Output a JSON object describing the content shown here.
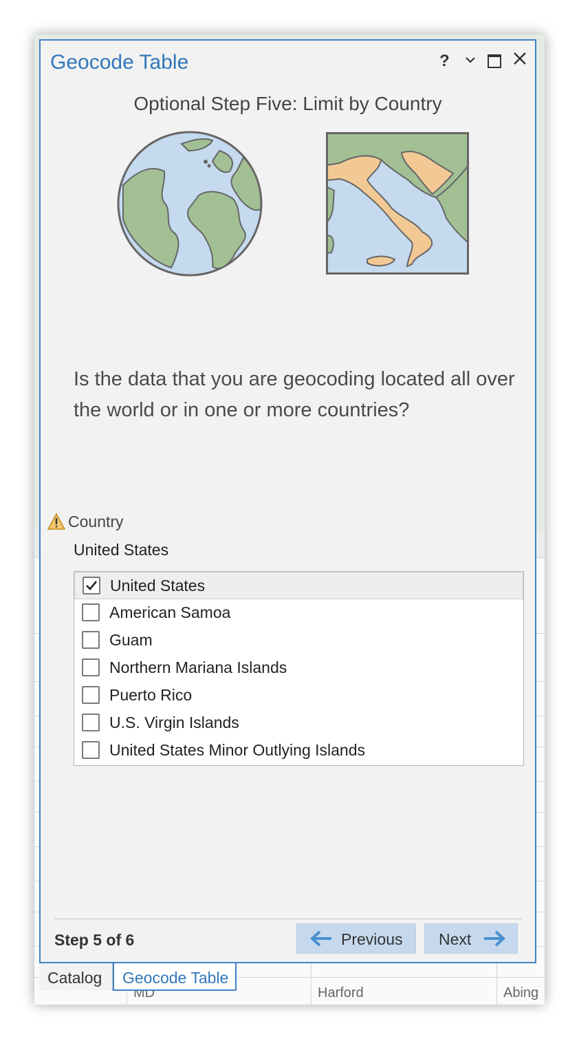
{
  "panel": {
    "title": "Geocode Table",
    "help_label": "?",
    "menu_glyph": "⌄",
    "close_glyph": "✕"
  },
  "wizard": {
    "heading": "Optional Step Five: Limit by Country",
    "question": "Is the data that you are geocoding located all over the world or in one or more countries?",
    "field_label": "Country",
    "field_value": "United States",
    "countries": [
      {
        "label": "United States",
        "checked": true
      },
      {
        "label": "American Samoa",
        "checked": false
      },
      {
        "label": "Guam",
        "checked": false
      },
      {
        "label": "Northern Mariana Islands",
        "checked": false
      },
      {
        "label": "Puerto Rico",
        "checked": false
      },
      {
        "label": "U.S. Virgin Islands",
        "checked": false
      },
      {
        "label": "United States Minor Outlying Islands",
        "checked": false
      }
    ],
    "step_counter": "Step 5 of 6",
    "previous_label": "Previous",
    "next_label": "Next"
  },
  "tabs": [
    {
      "label": "Catalog",
      "active": false
    },
    {
      "label": "Geocode Table",
      "active": true
    }
  ],
  "background": {
    "row_text_1": "MD",
    "row_text_2": "Harford",
    "row_text_3": "Abing"
  },
  "colors": {
    "accent": "#3177bb",
    "button_bg": "#c5d8ed",
    "ocean": "#c5daee",
    "land": "#a3c095",
    "highlight_country": "#f2c994",
    "warning": "#e8a33a"
  },
  "icons": {
    "warning": "warning-icon",
    "prev_arrow": "arrow-left-icon",
    "next_arrow": "arrow-right-icon",
    "check": "checkmark-icon",
    "globe": "globe-illustration",
    "country_map": "italy-map-illustration"
  }
}
